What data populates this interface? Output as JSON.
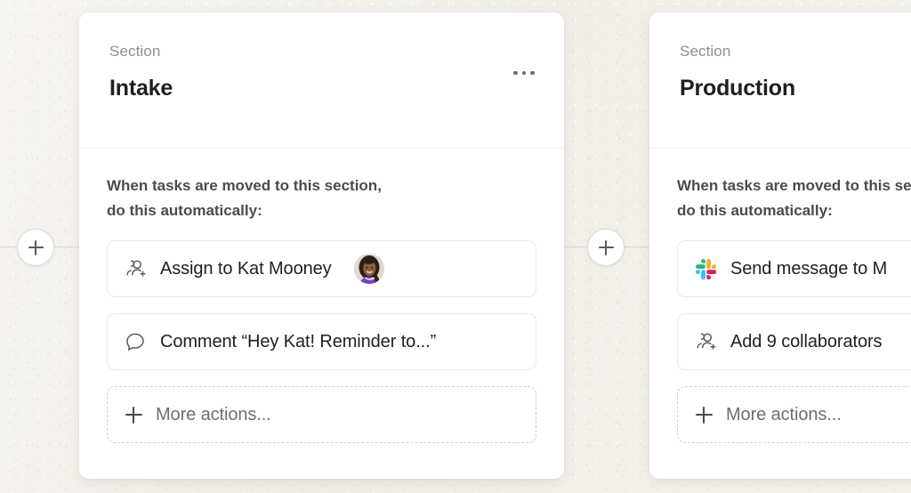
{
  "board": {
    "background_color": "#f3f0ea",
    "connector_color": "#dcd8d0"
  },
  "connectors": [
    {
      "name": "add-section-left",
      "label": "+"
    },
    {
      "name": "add-section-middle",
      "label": "+"
    }
  ],
  "sections": [
    {
      "eyebrow": "Section",
      "title": "Intake",
      "menu_label": "•••",
      "prompt_line1": "When tasks are moved to this section,",
      "prompt_line2": "do this automatically:",
      "actions": [
        {
          "icon": "add-person-icon",
          "label": "Assign to Kat Mooney",
          "avatar": "kat-mooney-avatar",
          "style": "solid"
        },
        {
          "icon": "comment-bubble-icon",
          "label": "Comment “Hey Kat! Reminder to...”",
          "style": "solid"
        },
        {
          "icon": "plus-icon",
          "label": "More actions...",
          "style": "dashed"
        }
      ]
    },
    {
      "eyebrow": "Section",
      "title": "Production",
      "menu_label": "•••",
      "prompt_line1": "When tasks are moved to this section,",
      "prompt_line2": "do this automatically:",
      "actions": [
        {
          "icon": "slack-icon",
          "label": "Send message to M",
          "style": "solid"
        },
        {
          "icon": "add-person-icon",
          "label": "Add 9 collaborators",
          "style": "solid"
        },
        {
          "icon": "plus-icon",
          "label": "More actions...",
          "style": "dashed"
        }
      ]
    }
  ],
  "colors": {
    "card_background": "#ffffff",
    "title_text": "#1e1f21",
    "eyebrow_text": "#8e8e93",
    "body_text": "#4b4b4d",
    "row_border": "#eceae7",
    "dashed_border": "#d2cfca",
    "slack_green": "#2eb67d",
    "slack_blue": "#36c5f0",
    "slack_red": "#e01e5a",
    "slack_yellow": "#ecb22e"
  }
}
